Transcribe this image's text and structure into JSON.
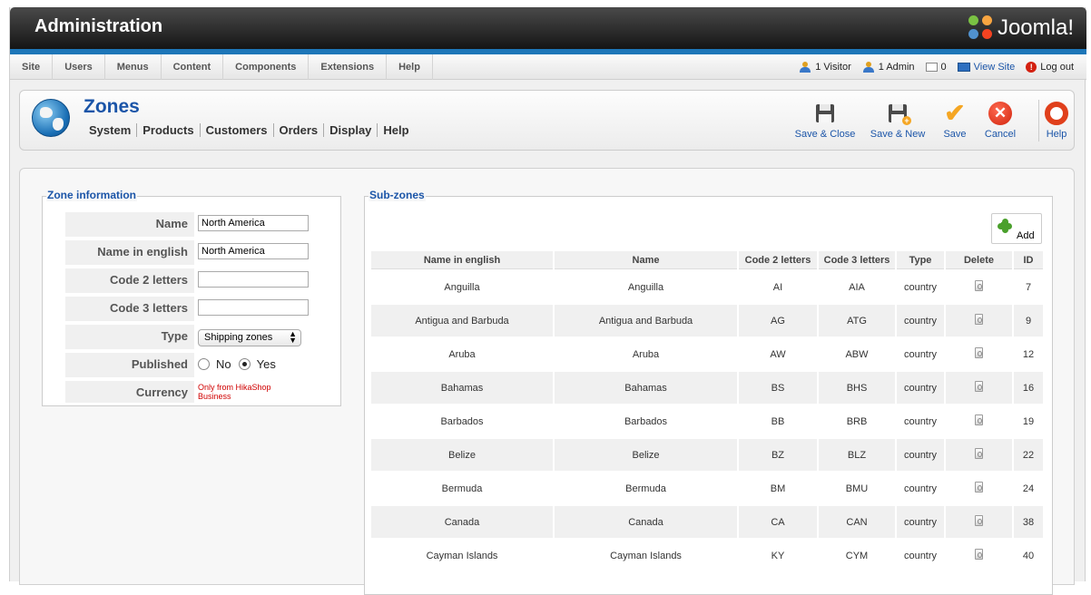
{
  "header": {
    "title": "Administration",
    "logo_text": "Joomla!"
  },
  "menu": {
    "items": [
      "Site",
      "Users",
      "Menus",
      "Content",
      "Components",
      "Extensions",
      "Help"
    ]
  },
  "status": {
    "visitors": "1 Visitor",
    "admins": "1 Admin",
    "messages": "0",
    "view_site": "View Site",
    "logout": "Log out"
  },
  "page": {
    "title": "Zones",
    "submenu": [
      "System",
      "Products",
      "Customers",
      "Orders",
      "Display",
      "Help"
    ]
  },
  "toolbar": {
    "save_close": "Save & Close",
    "save_new": "Save & New",
    "save": "Save",
    "cancel": "Cancel",
    "help": "Help"
  },
  "zone_info": {
    "legend": "Zone information",
    "name_label": "Name",
    "name_value": "North America",
    "name_english_label": "Name in english",
    "name_english_value": "North America",
    "code2_label": "Code 2 letters",
    "code2_value": "",
    "code3_label": "Code 3 letters",
    "code3_value": "",
    "type_label": "Type",
    "type_value": "Shipping zones",
    "published_label": "Published",
    "published_no": "No",
    "published_yes": "Yes",
    "published_selected": "Yes",
    "currency_label": "Currency",
    "currency_note": "Only from HikaShop Business"
  },
  "subzones": {
    "legend": "Sub-zones",
    "add_label": "Add",
    "columns": [
      "Name in english",
      "Name",
      "Code 2 letters",
      "Code 3 letters",
      "Type",
      "Delete",
      "ID"
    ],
    "rows": [
      {
        "name_english": "Anguilla",
        "name": "Anguilla",
        "code2": "AI",
        "code3": "AIA",
        "type": "country",
        "id": "7"
      },
      {
        "name_english": "Antigua and Barbuda",
        "name": "Antigua and Barbuda",
        "code2": "AG",
        "code3": "ATG",
        "type": "country",
        "id": "9"
      },
      {
        "name_english": "Aruba",
        "name": "Aruba",
        "code2": "AW",
        "code3": "ABW",
        "type": "country",
        "id": "12"
      },
      {
        "name_english": "Bahamas",
        "name": "Bahamas",
        "code2": "BS",
        "code3": "BHS",
        "type": "country",
        "id": "16"
      },
      {
        "name_english": "Barbados",
        "name": "Barbados",
        "code2": "BB",
        "code3": "BRB",
        "type": "country",
        "id": "19"
      },
      {
        "name_english": "Belize",
        "name": "Belize",
        "code2": "BZ",
        "code3": "BLZ",
        "type": "country",
        "id": "22"
      },
      {
        "name_english": "Bermuda",
        "name": "Bermuda",
        "code2": "BM",
        "code3": "BMU",
        "type": "country",
        "id": "24"
      },
      {
        "name_english": "Canada",
        "name": "Canada",
        "code2": "CA",
        "code3": "CAN",
        "type": "country",
        "id": "38"
      },
      {
        "name_english": "Cayman Islands",
        "name": "Cayman Islands",
        "code2": "KY",
        "code3": "CYM",
        "type": "country",
        "id": "40"
      }
    ]
  },
  "colors": {
    "accent_blue": "#1b55a8",
    "header_bar": "#1d76b8",
    "note_red": "#d00000"
  }
}
